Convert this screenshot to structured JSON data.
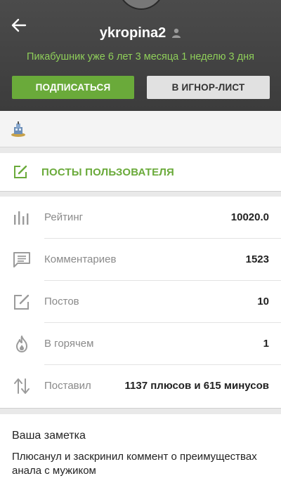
{
  "profile": {
    "username": "ykropina2",
    "status": "Пикабушник уже 6 лет 3 месяца 1 неделю 3 дня"
  },
  "actions": {
    "subscribe_label": "ПОДПИСАТЬСЯ",
    "ignore_label": "В ИГНОР-ЛИСТ"
  },
  "posts_link": {
    "label": "ПОСТЫ ПОЛЬЗОВАТЕЛЯ"
  },
  "stats": [
    {
      "icon": "bar-chart-icon",
      "label": "Рейтинг",
      "value": "10020.0"
    },
    {
      "icon": "comment-icon",
      "label": "Комментариев",
      "value": "1523"
    },
    {
      "icon": "edit-icon",
      "label": "Постов",
      "value": "10"
    },
    {
      "icon": "flame-icon",
      "label": "В горячем",
      "value": "1"
    },
    {
      "icon": "up-down-arrows-icon",
      "label": "Поставил",
      "value": "1137 плюсов и 615 минусов"
    }
  ],
  "note": {
    "title": "Ваша заметка",
    "text": "Плюсанул и заскринил коммент о преимуществах анала с мужиком"
  },
  "colors": {
    "accent_green": "#6aaa3a",
    "status_green": "#8fcf5a",
    "header_bg": "#444444"
  }
}
